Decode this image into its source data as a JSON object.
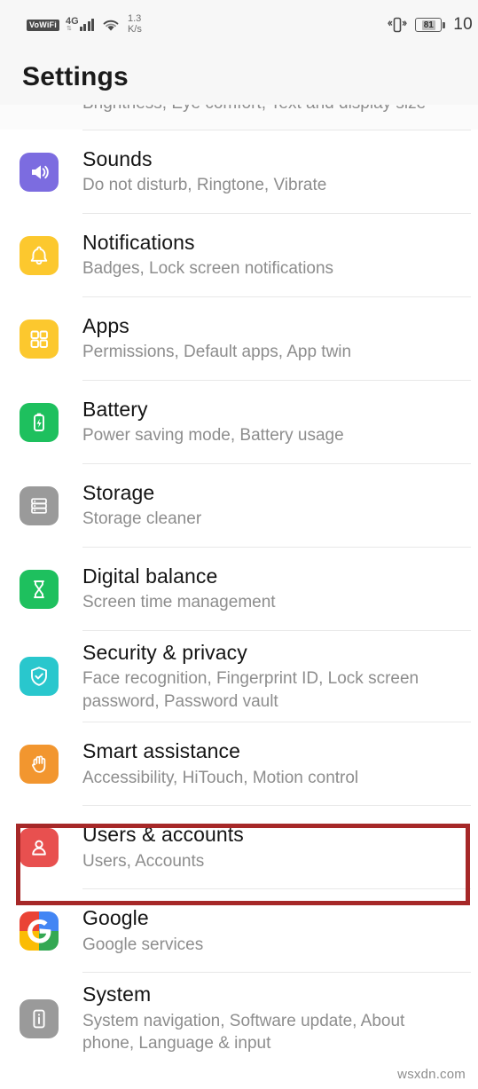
{
  "statusbar": {
    "vowifi_label": "VoWiFi",
    "network_gen": "4G",
    "speed_value": "1.3",
    "speed_unit": "K/s",
    "battery_percent": "81",
    "clock": "10",
    "icons": [
      "vowifi-badge",
      "signal-bars-icon",
      "wifi-icon",
      "vibrate-icon",
      "battery-icon"
    ]
  },
  "header": {
    "title": "Settings"
  },
  "scrolled_partial_row": {
    "subtitle": "Brightness, Eye comfort, Text and display size"
  },
  "items": [
    {
      "title": "Sounds",
      "subtitle": "Do not disturb, Ringtone, Vibrate",
      "icon": "speaker-icon",
      "color": "#7c6ce0"
    },
    {
      "title": "Notifications",
      "subtitle": "Badges, Lock screen notifications",
      "icon": "bell-icon",
      "color": "#fcc82e"
    },
    {
      "title": "Apps",
      "subtitle": "Permissions, Default apps, App twin",
      "icon": "apps-grid-icon",
      "color": "#fcc82e"
    },
    {
      "title": "Battery",
      "subtitle": "Power saving mode, Battery usage",
      "icon": "battery-bolt-icon",
      "color": "#1ec05e"
    },
    {
      "title": "Storage",
      "subtitle": "Storage cleaner",
      "icon": "storage-list-icon",
      "color": "#9a9a9a"
    },
    {
      "title": "Digital balance",
      "subtitle": "Screen time management",
      "icon": "hourglass-icon",
      "color": "#1ec05e"
    },
    {
      "title": "Security & privacy",
      "subtitle": "Face recognition, Fingerprint ID, Lock screen password, Password vault",
      "icon": "shield-check-icon",
      "color": "#29c7cd"
    },
    {
      "title": "Smart assistance",
      "subtitle": "Accessibility, HiTouch, Motion control",
      "icon": "hand-icon",
      "color": "#f2962f"
    },
    {
      "title": "Users & accounts",
      "subtitle": "Users, Accounts",
      "icon": "person-icon",
      "color": "#e8504f",
      "highlighted": true
    },
    {
      "title": "Google",
      "subtitle": "Google services",
      "icon": "google-g-icon",
      "color": "#ffffff"
    },
    {
      "title": "System",
      "subtitle": "System navigation, Software update, About phone, Language & input",
      "icon": "phone-info-icon",
      "color": "#9a9a9a"
    }
  ],
  "highlight": {
    "color": "#a62828",
    "target": "Users & accounts"
  },
  "watermark": {
    "text": "wsxdn.com"
  }
}
